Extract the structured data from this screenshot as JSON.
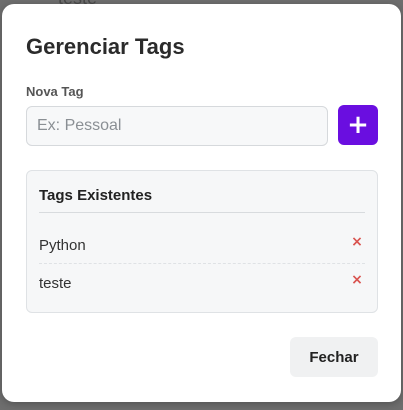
{
  "backdrop": {
    "fragment": "teste"
  },
  "modal": {
    "title": "Gerenciar Tags",
    "new_tag": {
      "label": "Nova Tag",
      "placeholder": "Ex: Pessoal",
      "value": ""
    },
    "add_button": {
      "label": "+",
      "color": "#6a0ee0"
    },
    "existing": {
      "title": "Tags Existentes",
      "tags": [
        {
          "name": "Python",
          "remove_icon": "×"
        },
        {
          "name": "teste",
          "remove_icon": "×"
        }
      ],
      "remove_color": "#d9534f"
    },
    "close_button": {
      "label": "Fechar"
    }
  }
}
